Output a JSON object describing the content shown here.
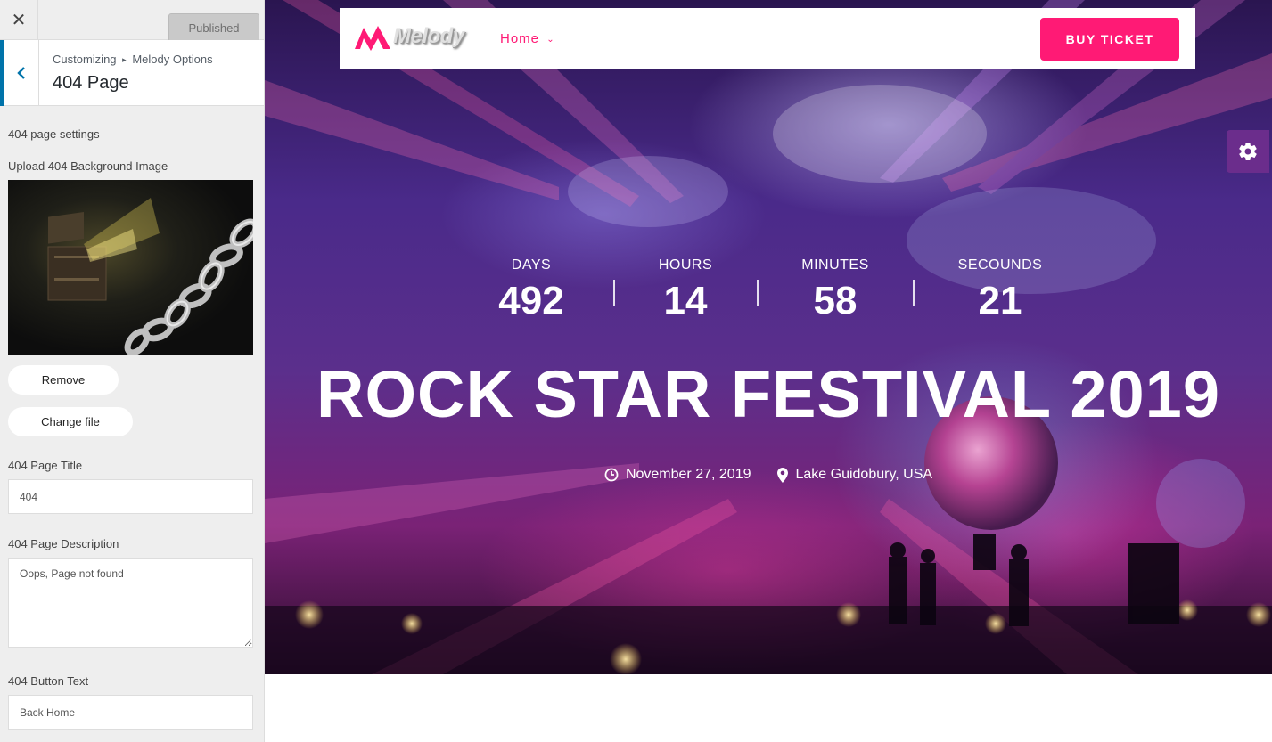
{
  "customizer": {
    "close_icon": "close-icon",
    "publish_label": "Published",
    "breadcrumb": [
      "Customizing",
      "Melody Options"
    ],
    "breadcrumb_separator": "▸",
    "panel_title": "404 Page",
    "section_title": "404 page settings",
    "bg_upload_label": "Upload 404 Background Image",
    "remove_label": "Remove",
    "change_file_label": "Change file",
    "page_title_label": "404 Page Title",
    "page_title_value": "404",
    "page_description_label": "404 Page Description",
    "page_description_value": "Oops, Page not found",
    "button_text_label": "404 Button Text",
    "button_text_value": "Back Home",
    "accent_color": "#0073aa"
  },
  "preview": {
    "logo_text": "Melody",
    "nav_home": "Home",
    "buy_ticket": "BUY TICKET",
    "accent_color": "#ff1a75",
    "countdown": [
      {
        "label": "DAYS",
        "value": "492"
      },
      {
        "label": "HOURS",
        "value": "14"
      },
      {
        "label": "MINUTES",
        "value": "58"
      },
      {
        "label": "SECOUNDS",
        "value": "21"
      }
    ],
    "festival_title": "ROCK STAR FESTIVAL 2019",
    "event_date": "November 27, 2019",
    "event_location": "Lake Guidobury, USA",
    "settings_icon": "gear-icon"
  }
}
